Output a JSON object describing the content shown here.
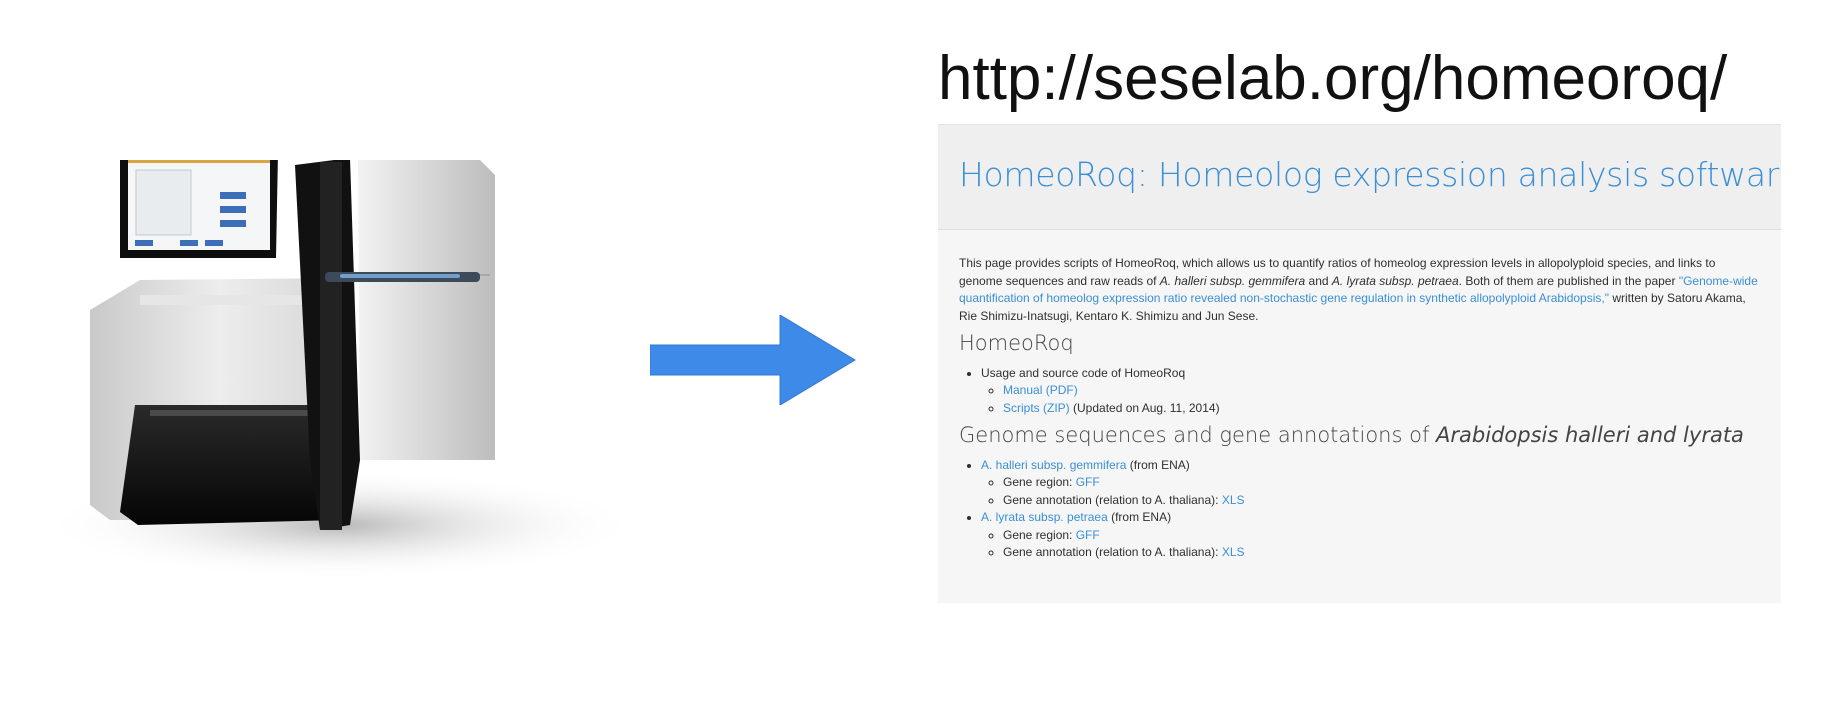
{
  "url_caption": "http://seselab.org/homeoroq/",
  "colors": {
    "accent": "#3a8fd6",
    "arrow": "#3d8ae8"
  },
  "icons": {
    "machine": "sequencer-machine-icon",
    "arrow": "right-arrow-icon"
  },
  "website": {
    "title": "HomeoRoq: Homeolog expression analysis softwares",
    "intro": {
      "p1": "This page provides scripts of HomeoRoq, which allows us to quantify ratios of homeolog expression levels in allopolyploid species, and links to genome sequences and raw reads of ",
      "i1": "A. halleri subsp. gemmifera",
      "p2": " and ",
      "i2": "A. lyrata subsp. petraea",
      "p3": ". Both of them are published in the paper ",
      "paper_link": "\"Genome-wide quantification of homeolog expression ratio revealed non-stochastic gene regulation in synthetic allopolyploid Arabidopsis,\"",
      "p4": " written by Satoru Akama, Rie Shimizu-Inatsugi, Kentaro K. Shimizu and Jun Sese."
    },
    "section1": {
      "heading": "HomeoRoq",
      "item": "Usage and source code of HomeoRoq",
      "manual_link": "Manual (PDF)",
      "scripts_link": "Scripts (ZIP)",
      "scripts_note": " (Updated on Aug. 11, 2014)"
    },
    "section2": {
      "heading_plain": "Genome sequences and gene annotations of ",
      "heading_italic": "Arabidopsis halleri and lyrata",
      "species": [
        {
          "name": "A. halleri subsp. gemmifera",
          "source": " (from ENA)",
          "region_label": "Gene region: ",
          "region_link": "GFF",
          "annot_label": "Gene annotation (relation to A. thaliana): ",
          "annot_link": "XLS"
        },
        {
          "name": "A. lyrata subsp. petraea",
          "source": " (from ENA)",
          "region_label": "Gene region: ",
          "region_link": "GFF",
          "annot_label": "Gene annotation (relation to A. thaliana): ",
          "annot_link": "XLS"
        }
      ]
    }
  }
}
